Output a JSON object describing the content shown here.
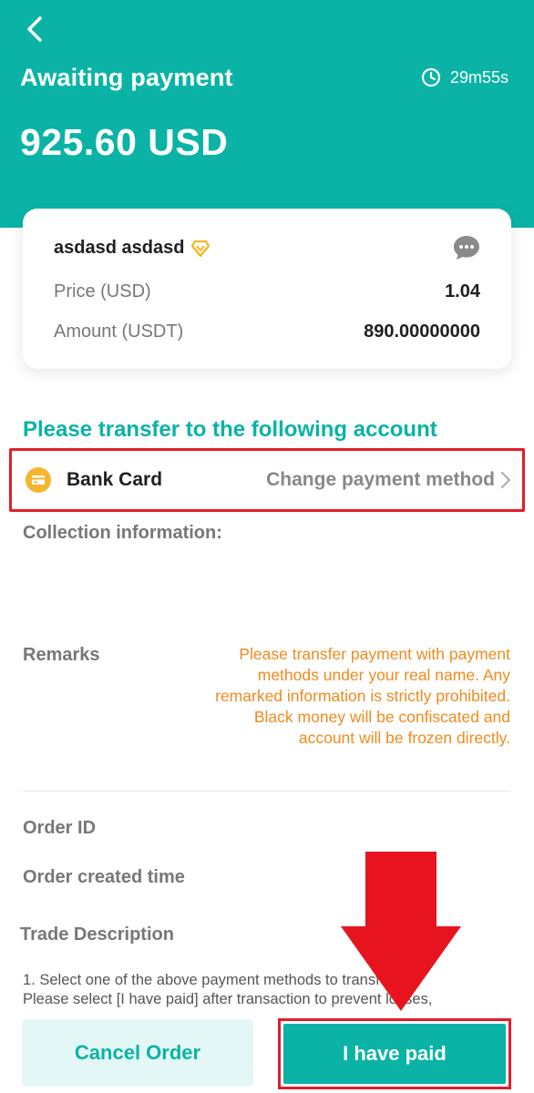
{
  "header": {
    "title": "Awaiting payment",
    "timer": "29m55s",
    "amount": "925.60 USD"
  },
  "order_card": {
    "seller_name": "asdasd asdasd",
    "price_label": "Price (USD)",
    "price_value": "1.04",
    "amount_label": "Amount (USDT)",
    "amount_value": "890.00000000"
  },
  "transfer": {
    "section_title": "Please transfer to the following account",
    "method_label": "Bank Card",
    "change_label": "Change payment method",
    "collection_label": "Collection information:",
    "remarks_label": "Remarks",
    "remarks_lines": [
      "Please transfer payment with payment",
      "methods under your real name. Any",
      "remarked information is strictly prohibited.",
      "Black money will be confiscated and",
      "account will be frozen directly."
    ]
  },
  "order_info": {
    "order_id_label": "Order ID",
    "created_time_label": "Order created time",
    "trade_title": "Trade Description",
    "trade_lines": [
      "1. Select one of the above payment methods to transfer.",
      "Please select [I have paid] after transaction to prevent losses,"
    ]
  },
  "actions": {
    "cancel_label": "Cancel Order",
    "paid_label": "I have paid"
  },
  "colors": {
    "brand": "#0ab3a6",
    "highlight": "#e21d2a",
    "warning_text": "#f08a1d",
    "vip_badge": "#f5b81d",
    "bank_icon": "#f5b52e"
  }
}
